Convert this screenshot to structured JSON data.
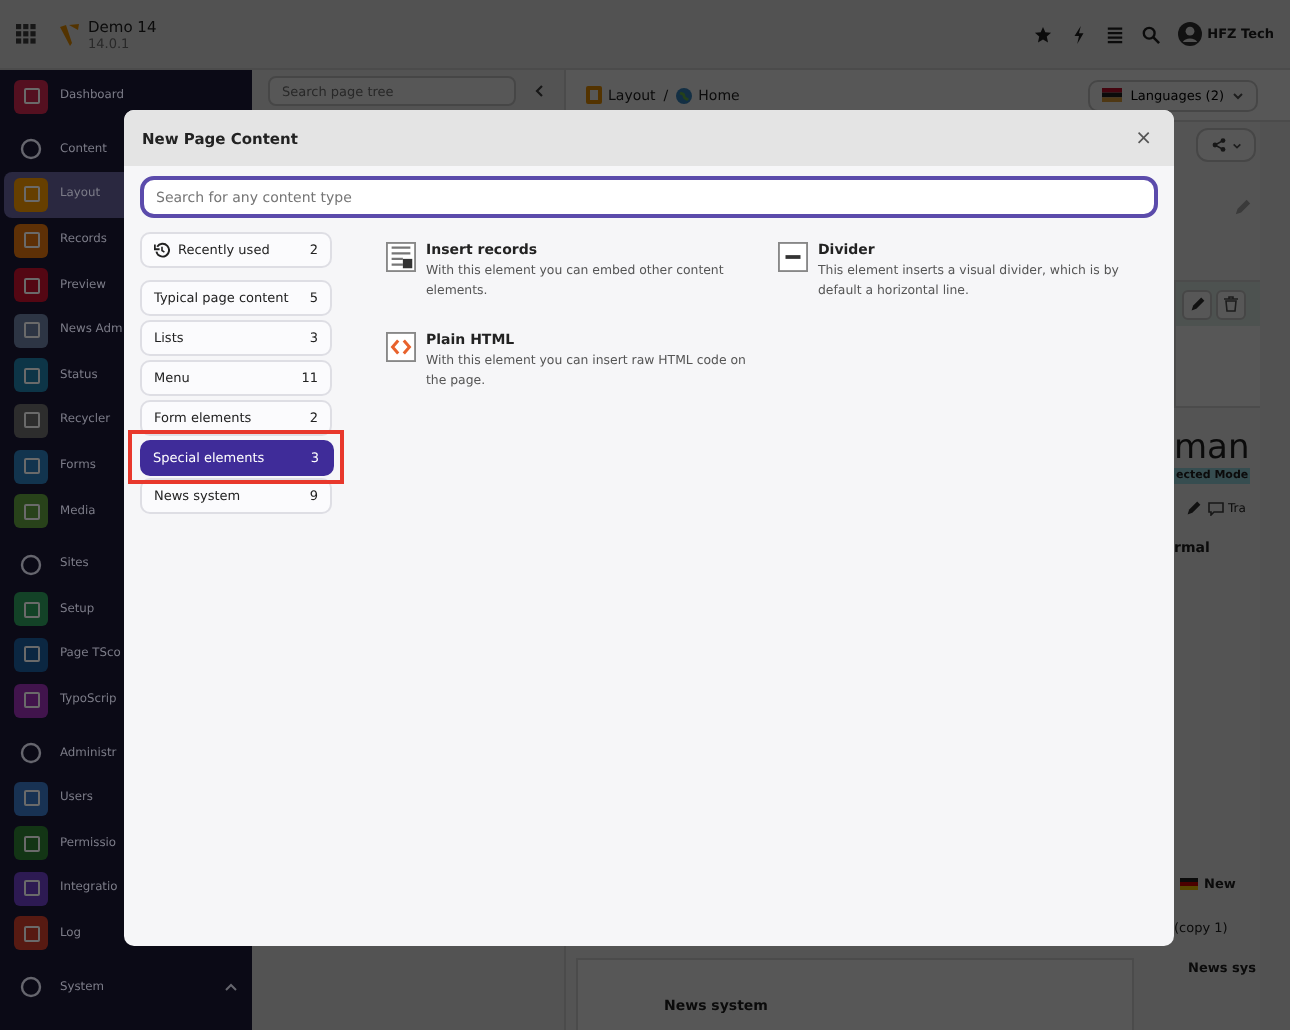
{
  "topbar": {
    "site_name": "Demo 14",
    "version": "14.0.1",
    "user": "HFZ Tech"
  },
  "sidebar": {
    "items": [
      {
        "label": "Dashboard",
        "kind": "module",
        "color": "#541020",
        "selected": false
      },
      {
        "label": "Content",
        "kind": "group",
        "selected": false
      },
      {
        "label": "Layout",
        "kind": "module",
        "color": "#663f00",
        "selected": true
      },
      {
        "label": "Records",
        "kind": "module",
        "color": "#5e3006",
        "selected": false
      },
      {
        "label": "Preview",
        "kind": "module",
        "color": "#540713",
        "selected": false
      },
      {
        "label": "News Adm",
        "kind": "module",
        "color": "#2d3544",
        "selected": false
      },
      {
        "label": "Status",
        "kind": "module",
        "color": "#0d3547",
        "selected": false
      },
      {
        "label": "Recycler",
        "kind": "module",
        "color": "#2d2d2d",
        "selected": false
      },
      {
        "label": "Forms",
        "kind": "module",
        "color": "#12344e",
        "selected": false
      },
      {
        "label": "Media",
        "kind": "module",
        "color": "#28421a",
        "selected": false
      },
      {
        "label": "Sites",
        "kind": "group",
        "selected": false
      },
      {
        "label": "Setup",
        "kind": "module",
        "color": "#134227",
        "selected": false
      },
      {
        "label": "Page TSco",
        "kind": "module",
        "color": "#0b2742",
        "selected": false
      },
      {
        "label": "TypoScrip",
        "kind": "module",
        "color": "#41144c",
        "selected": false
      },
      {
        "label": "Administr",
        "kind": "group",
        "selected": false
      },
      {
        "label": "Users",
        "kind": "module",
        "color": "#183253",
        "selected": false
      },
      {
        "label": "Permissio",
        "kind": "module",
        "color": "#133515",
        "selected": false
      },
      {
        "label": "Integratio",
        "kind": "module",
        "color": "#2d1a52",
        "selected": false
      },
      {
        "label": "Log",
        "kind": "module",
        "color": "#571a12",
        "selected": false
      },
      {
        "label": "System",
        "kind": "group",
        "expanded": true,
        "selected": false
      }
    ]
  },
  "page_tree": {
    "search": {
      "placeholder": "Search page tree"
    }
  },
  "breadcrumb": {
    "items": [
      "Layout",
      "Home"
    ],
    "separator": "/"
  },
  "languages_button": "Languages (2)",
  "content_column": {
    "row_label": "News system"
  },
  "language_column": {
    "heading": "man",
    "badge": "ected Mode",
    "toolbar_label": "Tra",
    "layout_label": "rmal",
    "record_title": "New",
    "record_suffix": "(copy 1)",
    "record_type": "News sys"
  },
  "modal": {
    "title": "New Page Content",
    "close": "×",
    "search": {
      "placeholder": "Search for any content type"
    },
    "categories": [
      {
        "label": "Recently used",
        "count": "2",
        "kind": "recent",
        "selected": false,
        "highlighted": false
      },
      {
        "label": "Typical page content",
        "count": "5",
        "kind": "group",
        "selected": false,
        "highlighted": false
      },
      {
        "label": "Lists",
        "count": "3",
        "kind": "group",
        "selected": false,
        "highlighted": false
      },
      {
        "label": "Menu",
        "count": "11",
        "kind": "group",
        "selected": false,
        "highlighted": false
      },
      {
        "label": "Form elements",
        "count": "2",
        "kind": "group",
        "selected": false,
        "highlighted": false
      },
      {
        "label": "Special elements",
        "count": "3",
        "kind": "group",
        "selected": true,
        "highlighted": true
      },
      {
        "label": "News system",
        "count": "9",
        "kind": "group",
        "selected": false,
        "highlighted": false
      }
    ],
    "elements": [
      {
        "title": "Insert records",
        "description": "With this element you can embed other content elements.",
        "kind": "records"
      },
      {
        "title": "Divider",
        "description": "This element inserts a visual divider, which is by default a horizontal line.",
        "kind": "divider"
      },
      {
        "title": "Plain HTML",
        "description": "With this element you can insert raw HTML code on the page.",
        "kind": "html"
      }
    ]
  }
}
